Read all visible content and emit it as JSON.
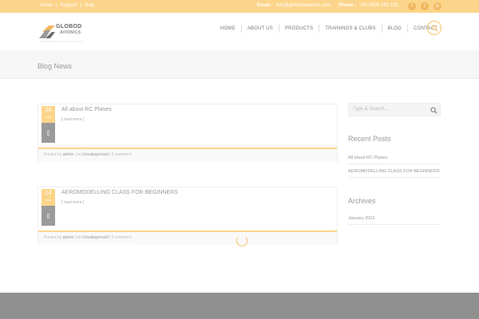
{
  "topbar": {
    "links": [
      "Home",
      "Support",
      "Help"
    ],
    "email_label": "Email :",
    "email_value": "info@globodavionics.com",
    "phone_label": "Phone :",
    "phone_value": "+91 9900 281 131"
  },
  "header": {
    "logo_text": "GLOBOD",
    "logo_sub": "AVIONICS",
    "nav": [
      "HOME",
      "ABOUT US",
      "PRODUCTS",
      "TRAININGS & CLUBS",
      "BLOG",
      "CONTACT"
    ]
  },
  "page": {
    "title": "Blog News"
  },
  "posts": [
    {
      "day": "20",
      "month": "Jan",
      "title": "All about RC Planes",
      "readmore": "[ read more ]",
      "meta_posted": "Posted by",
      "meta_author": "admin",
      "meta_in": "| on",
      "meta_category": "Uncategorized",
      "meta_comments": "| 0 comment"
    },
    {
      "day": "14",
      "month": "Jan",
      "title": "AEROMODELLING CLASS FOR BEGINNERS",
      "readmore": "[ read more ]",
      "meta_posted": "Posted by",
      "meta_author": "admin",
      "meta_in": "| on",
      "meta_category": "Uncategorized",
      "meta_comments": "| 0 comment"
    }
  ],
  "sidebar": {
    "search_placeholder": "Type & Search...",
    "recent_heading": "Recent Posts",
    "recent_posts": [
      "All about RC Planes",
      "AEROMODELLING CLASS FOR BEGINNERS"
    ],
    "archives_heading": "Archives",
    "archives": [
      "January 2023"
    ]
  },
  "colors": {
    "accent": "#fcd58a",
    "accent_dark": "#f0b75e",
    "footer": "#8f8f8f"
  },
  "icons": {
    "social": [
      "facebook-icon",
      "twitter-icon",
      "linkedin-icon"
    ],
    "format": "document-icon"
  }
}
